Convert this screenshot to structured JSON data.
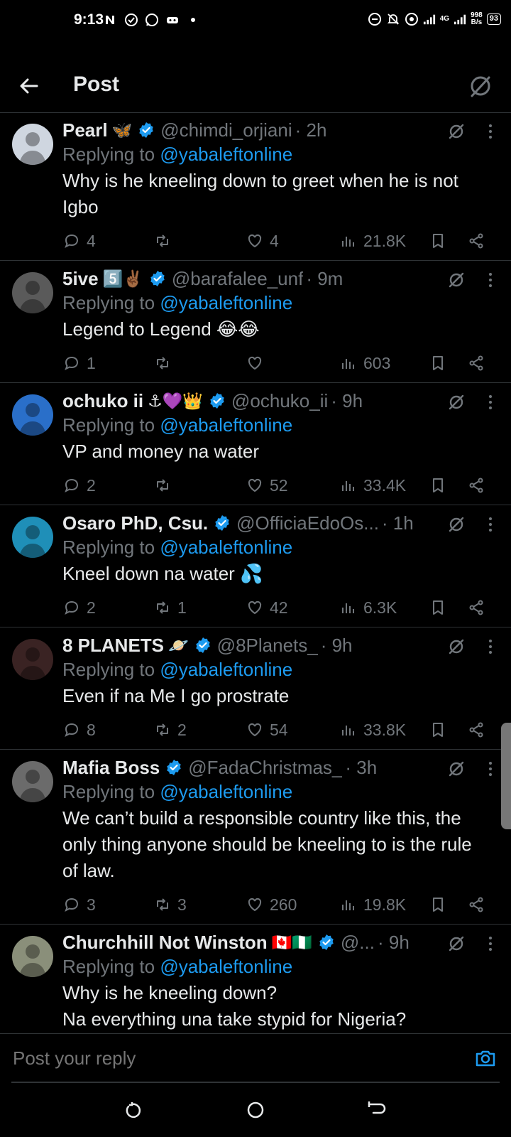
{
  "status_bar": {
    "time": "9:13",
    "net_speed_value": "998",
    "net_speed_unit": "B/s",
    "signal_label": "4G",
    "battery": "93"
  },
  "header": {
    "title": "Post"
  },
  "replies": [
    {
      "name": "Pearl",
      "name_emoji": "🦋",
      "handle": "@chimdi_orjiani",
      "time": "· 2h",
      "replying_prefix": "Replying to",
      "replying_to": "@yabaleftonline",
      "text": "Why is he kneeling down to greet when he is not Igbo",
      "replies": "4",
      "reposts": "",
      "likes": "4",
      "views": "21.8K",
      "avatar_color": "#cfd6e0"
    },
    {
      "name": "5ive",
      "name_emoji": "5️⃣✌🏾",
      "handle": "@barafalee_unf",
      "time": "· 9m",
      "replying_prefix": "Replying to",
      "replying_to": "@yabaleftonline",
      "text": "Legend to Legend 😂😂",
      "replies": "1",
      "reposts": "",
      "likes": "",
      "views": "603",
      "avatar_color": "#5a5a5a"
    },
    {
      "name": "ochuko ii",
      "name_emoji": "⚓💜👑",
      "handle": "@ochuko_ii",
      "time": "· 9h",
      "replying_prefix": "Replying to",
      "replying_to": "@yabaleftonline",
      "text": "VP and money na water",
      "replies": "2",
      "reposts": "",
      "likes": "52",
      "views": "33.4K",
      "avatar_color": "#2a6fc9"
    },
    {
      "name": "Osaro PhD, Csu.",
      "name_emoji": "",
      "handle": "@OfficiaEdoOs...",
      "time": "· 1h",
      "replying_prefix": "Replying to",
      "replying_to": "@yabaleftonline",
      "text": "Kneel down na water 💦",
      "replies": "2",
      "reposts": "1",
      "likes": "42",
      "views": "6.3K",
      "avatar_color": "#1f8fb8"
    },
    {
      "name": "8 PLANETS",
      "name_emoji": "🪐",
      "handle": "@8Planets_",
      "time": "· 9h",
      "replying_prefix": "Replying to",
      "replying_to": "@yabaleftonline",
      "text": "Even if na Me I go prostrate",
      "replies": "8",
      "reposts": "2",
      "likes": "54",
      "views": "33.8K",
      "avatar_color": "#3a2323"
    },
    {
      "name": "Mafia Boss",
      "name_emoji": "",
      "handle": "@FadaChristmas_",
      "time": "· 3h",
      "replying_prefix": "Replying to",
      "replying_to": "@yabaleftonline",
      "text": "We can’t build a responsible country like this, the only thing anyone should be kneeling to is the rule of law.",
      "replies": "3",
      "reposts": "3",
      "likes": "260",
      "views": "19.8K",
      "avatar_color": "#6b6b6b"
    },
    {
      "name": "Churchhill Not Winston",
      "name_emoji": "🇨🇦🇳🇬",
      "handle": "@...",
      "time": "· 9h",
      "replying_prefix": "Replying to",
      "replying_to": "@yabaleftonline",
      "text": "Why is he kneeling down?\nNa everything una take stypid for Nigeria?",
      "replies": "",
      "reposts": "",
      "likes": "",
      "views": "",
      "avatar_color": "#8a8f7a"
    }
  ],
  "compose": {
    "placeholder": "Post your reply"
  },
  "colors": {
    "background": "#000000",
    "accent": "#1d9bf0",
    "muted": "#71767b",
    "divider": "#2f3336"
  }
}
